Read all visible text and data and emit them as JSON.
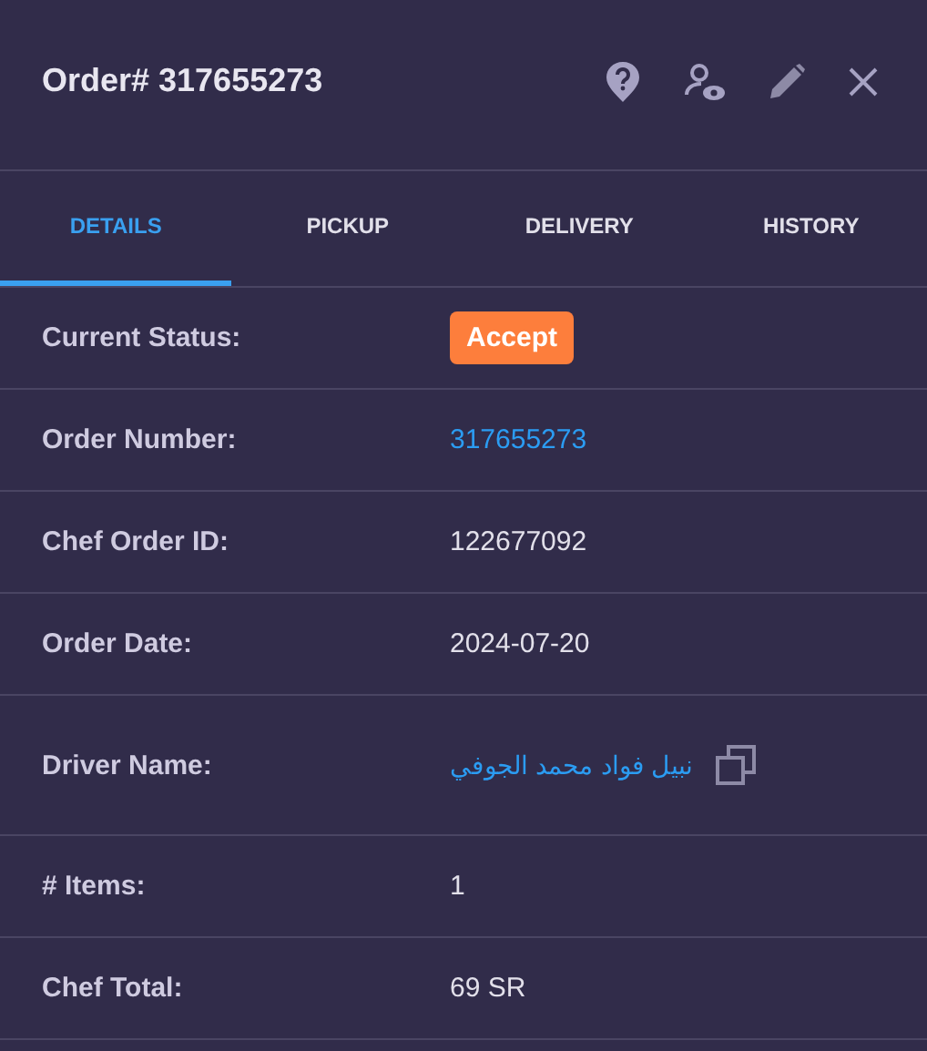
{
  "title": "Order# 317655273",
  "tabs": [
    {
      "label": "DETAILS",
      "selected": true
    },
    {
      "label": "PICKUP",
      "selected": false
    },
    {
      "label": "DELIVERY",
      "selected": false
    },
    {
      "label": "HISTORY",
      "selected": false
    }
  ],
  "rows": [
    {
      "kind": "status",
      "label": "Current Status:",
      "value": "Accept"
    },
    {
      "kind": "link",
      "label": "Order Number:",
      "value": "317655273"
    },
    {
      "kind": "text",
      "label": "Chef Order ID:",
      "value": "122677092"
    },
    {
      "kind": "text",
      "label": "Order Date:",
      "value": "2024-07-20"
    },
    {
      "kind": "driver",
      "label": "Driver Name:",
      "value": "نبيل فواد محمد الجوفي"
    },
    {
      "kind": "text",
      "label": "# Items:",
      "value": "1"
    },
    {
      "kind": "text",
      "label": "Chef Total:",
      "value": "69 SR"
    }
  ]
}
